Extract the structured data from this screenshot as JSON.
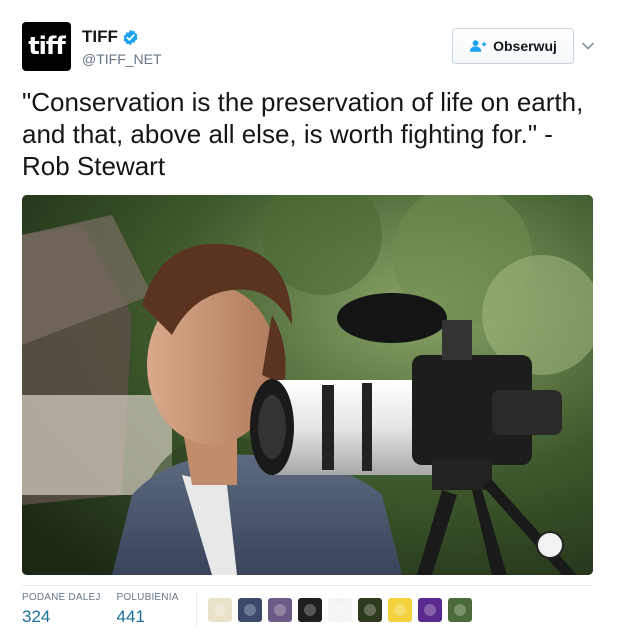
{
  "account": {
    "avatar_text": "tiff",
    "display_name": "TIFF",
    "handle": "@TIFF_NET",
    "verified": true
  },
  "follow_button": {
    "label": "Obserwuj",
    "icon": "add-user-icon"
  },
  "menu_caret_icon": "chevron-down-icon",
  "tweet": {
    "text": "\"Conservation is the preservation of life on earth, and that, above all else, is worth fighting for.\" - Rob Stewart"
  },
  "photo": {
    "subject": "man with camera"
  },
  "stats": {
    "retweets_label": "PODANE DALEJ",
    "retweets_value": "324",
    "likes_label": "POLUBIENIA",
    "likes_value": "441"
  },
  "likers": [
    {
      "color": "#e8e2c9"
    },
    {
      "color": "#3b4a6b"
    },
    {
      "color": "#6b5a86"
    },
    {
      "color": "#1f1f1f"
    },
    {
      "color": "#f4f4f4"
    },
    {
      "color": "#2e3b1f"
    },
    {
      "color": "#f3d23b"
    },
    {
      "color": "#5a2b8c"
    },
    {
      "color": "#4c6b3a"
    }
  ],
  "colors": {
    "accent": "#1da1f2",
    "stat_value": "#1b6f9e",
    "muted": "#657786"
  }
}
